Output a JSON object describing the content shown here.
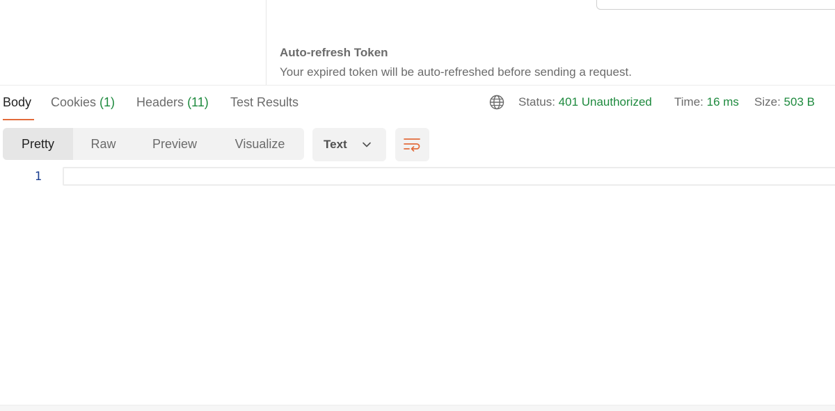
{
  "auth": {
    "title": "Auto-refresh Token",
    "description": "Your expired token will be auto-refreshed before sending a request."
  },
  "response": {
    "tabs": [
      {
        "label": "Body",
        "count": ""
      },
      {
        "label": "Cookies",
        "count": "(1)"
      },
      {
        "label": "Headers",
        "count": "(11)"
      },
      {
        "label": "Test Results",
        "count": ""
      }
    ],
    "globe_icon": "globe-icon",
    "status_label": "Status:",
    "status_value": "401 Unauthorized",
    "time_label": "Time:",
    "time_value": "16 ms",
    "size_label": "Size:",
    "size_value": "503 B"
  },
  "view": {
    "modes": [
      "Pretty",
      "Raw",
      "Preview",
      "Visualize"
    ],
    "active_mode": "Pretty",
    "format": "Text",
    "wrap_icon": "wrap-lines-icon"
  },
  "editor": {
    "line_numbers": [
      "1"
    ]
  },
  "colors": {
    "accent": "#e26b3b",
    "success": "#1e8a3e",
    "line_number": "#1a3d8f"
  }
}
